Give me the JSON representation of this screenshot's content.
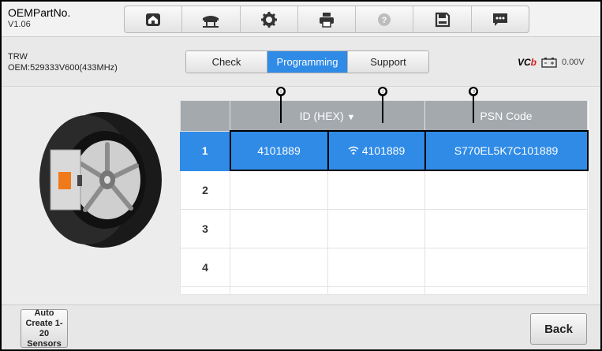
{
  "app": {
    "title": "OEMPartNo.",
    "version": "V1.06"
  },
  "toolbar": {
    "icons": [
      "home-icon",
      "vehicle-lift-icon",
      "gear-icon",
      "printer-icon",
      "help-icon",
      "save-icon",
      "message-icon"
    ]
  },
  "vehicle": {
    "make": "TRW",
    "oem": "OEM:529333V600(433MHz)"
  },
  "tabs": [
    {
      "label": "Check",
      "active": false
    },
    {
      "label": "Programming",
      "active": true
    },
    {
      "label": "Support",
      "active": false
    }
  ],
  "status": {
    "vci_label": "VC",
    "vci_label_accent": "b",
    "voltage": "0.00V"
  },
  "table": {
    "columns": [
      "",
      "ID (HEX)",
      "",
      "PSN Code"
    ],
    "sort_arrow": "▼",
    "rows": [
      {
        "num": "1",
        "id": "4101889",
        "wireless_id": "4101889",
        "psn": "S770EL5K7C101889",
        "selected": true
      },
      {
        "num": "2",
        "id": "",
        "wireless_id": "",
        "psn": "",
        "selected": false
      },
      {
        "num": "3",
        "id": "",
        "wireless_id": "",
        "psn": "",
        "selected": false
      },
      {
        "num": "4",
        "id": "",
        "wireless_id": "",
        "psn": "",
        "selected": false
      }
    ]
  },
  "callouts": [
    "❶",
    "❷",
    "❸"
  ],
  "buttons": {
    "auto_create": "Auto Create 1-20 Sensors",
    "back": "Back"
  },
  "colors": {
    "accent": "#2f8be6",
    "header": "#a4a9ae"
  }
}
